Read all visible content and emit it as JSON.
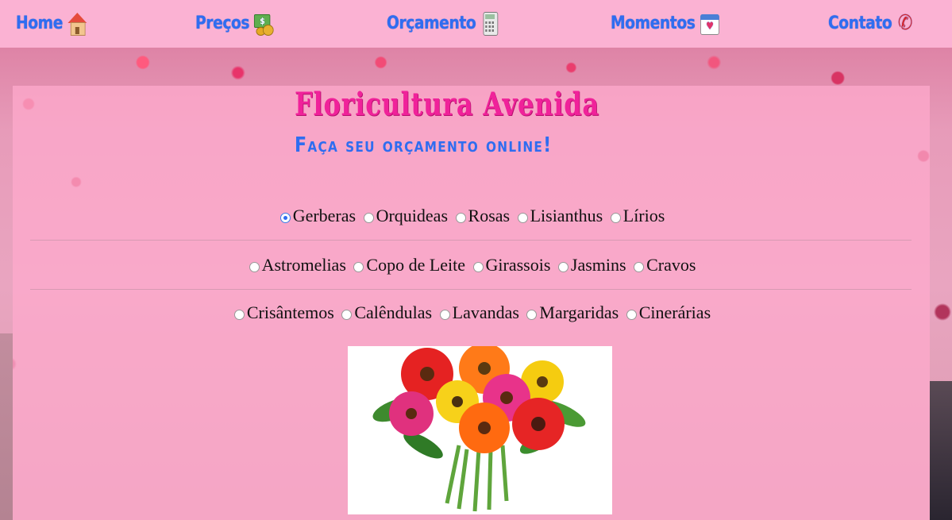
{
  "nav": {
    "items": [
      {
        "label": "Home",
        "icon": "house-icon"
      },
      {
        "label": "Preços",
        "icon": "money-icon"
      },
      {
        "label": "Orçamento",
        "icon": "calculator-icon"
      },
      {
        "label": "Momentos",
        "icon": "calendar-icon"
      },
      {
        "label": "Contato",
        "icon": "phone-icon"
      }
    ]
  },
  "header": {
    "title": "Floricultura Avenida",
    "subtitle": "Faça seu orçamento online!"
  },
  "flowers": {
    "rows": [
      [
        "Gerberas",
        "Orquideas",
        "Rosas",
        "Lisianthus",
        "Lírios"
      ],
      [
        "Astromelias",
        "Copo de Leite",
        "Girassois",
        "Jasmins",
        "Cravos"
      ],
      [
        "Crisântemos",
        "Calêndulas",
        "Lavandas",
        "Margaridas",
        "Cinerárias"
      ]
    ],
    "selected": "Gerberas"
  },
  "colors": {
    "nav_bg": "#fbb2d3",
    "nav_text": "#2f6df0",
    "title": "#f0229a",
    "subtitle": "#2f6df0"
  }
}
